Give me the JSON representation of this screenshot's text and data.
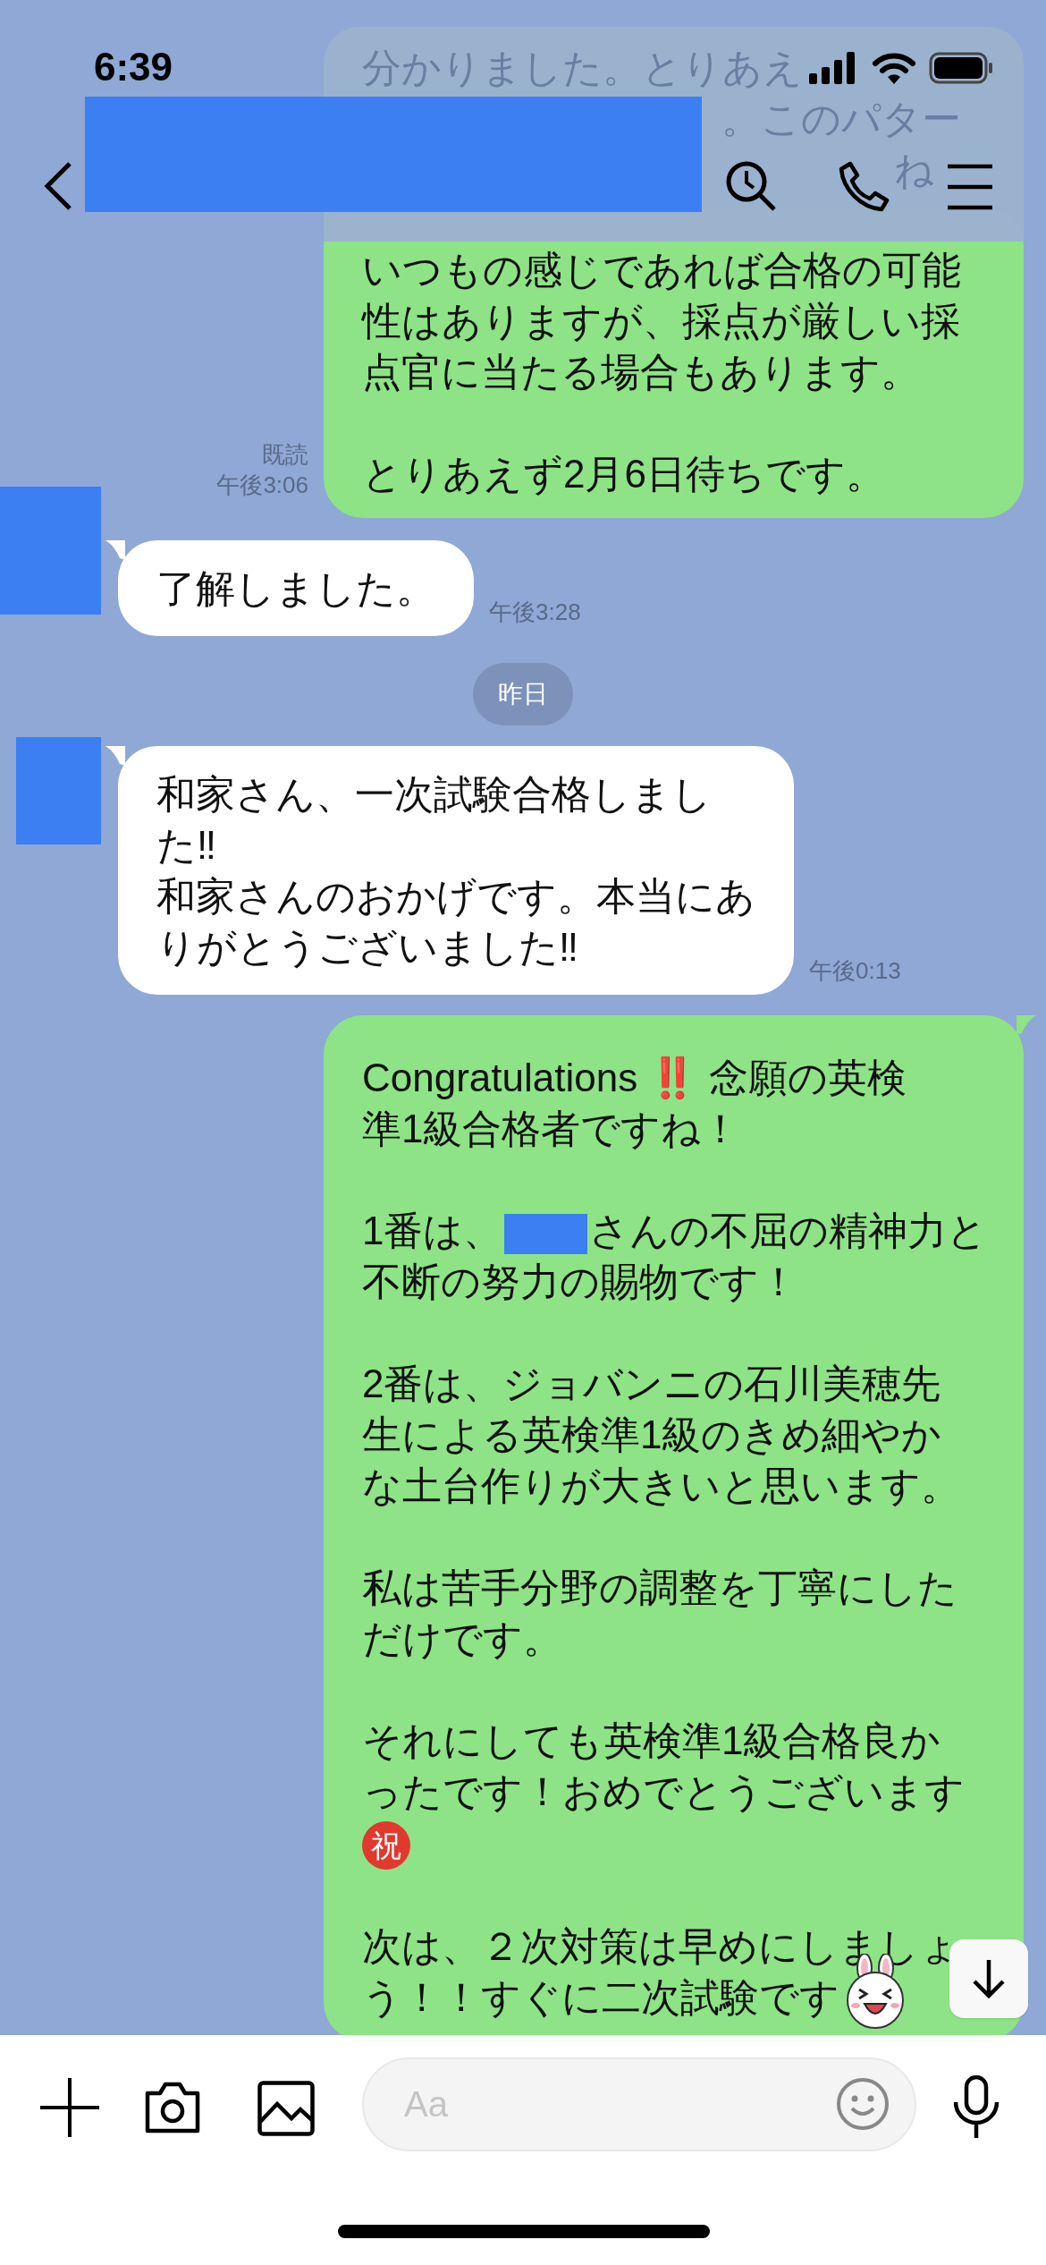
{
  "status_bar": {
    "time": "6:39"
  },
  "header": {
    "behind_text": [
      "分かりました。とりあえ",
      "。このパター",
      "ね"
    ]
  },
  "messages": [
    {
      "kind": "sent",
      "paragraphs": [
        [
          "いつもの感じであれば合格の可能",
          "性はありますが、採点が厳しい採",
          "点官に当たる場合もあります。"
        ],
        [
          "とりあえず2月6日待ちです。"
        ]
      ],
      "read": "既読",
      "time": "午後3:06"
    },
    {
      "kind": "received",
      "paragraphs": [
        [
          "了解しました。"
        ]
      ],
      "time": "午後3:28"
    },
    {
      "kind": "date",
      "text": "昨日"
    },
    {
      "kind": "received",
      "paragraphs": [
        [
          "和家さん、一次試験合格しまし",
          "た‼",
          "和家さんのおかげです。本当にあ",
          "りがとうございました‼"
        ]
      ],
      "time": "午後0:13"
    },
    {
      "kind": "sent",
      "paragraphs": [
        [
          [
            "Congratulations ",
            {
              "kind": "emoji",
              "text": "‼️"
            },
            " 念願の英検"
          ],
          "準1級合格者ですね！"
        ],
        [
          [
            "1番は、",
            {
              "kind": "redaction"
            },
            "さんの不屈の精神力と"
          ],
          "不断の努力の賜物です！"
        ],
        [
          "2番は、ジョバンニの石川美穂先",
          "生による英検準1級のきめ細やか",
          "な土台作りが大きいと思います。"
        ],
        [
          "私は苦手分野の調整を丁寧にした",
          "だけです。"
        ],
        [
          "それにしても英検準1級合格良か",
          "ったです！おめでとうございます",
          [
            {
              "kind": "seal",
              "text": "祝"
            }
          ]
        ],
        [
          "次は、２次対策は早めにしましょ",
          [
            "う！！すぐに二次試験です",
            {
              "kind": "sticker"
            }
          ]
        ]
      ]
    }
  ],
  "input": {
    "placeholder": "Aa"
  }
}
